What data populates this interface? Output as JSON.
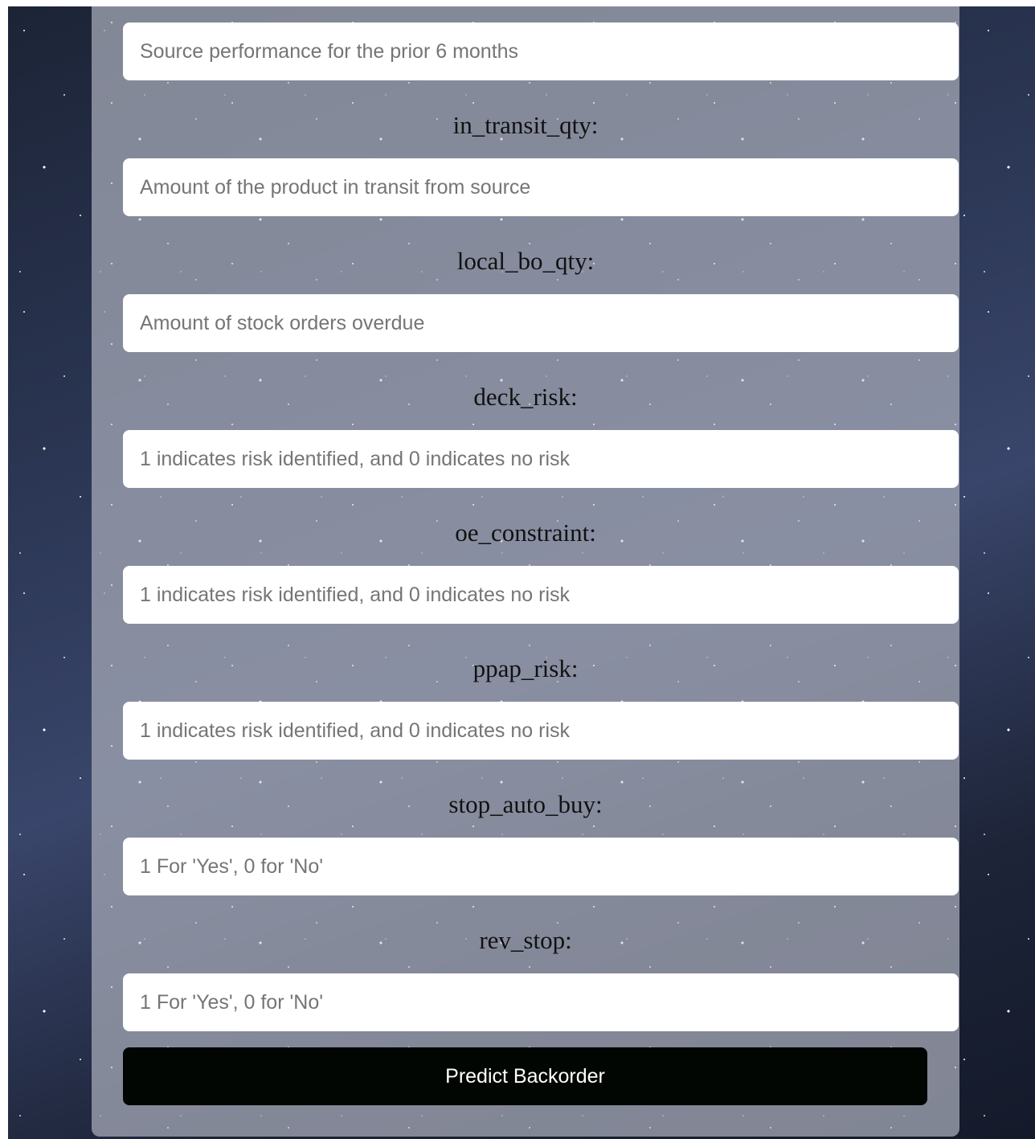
{
  "form": {
    "fields": [
      {
        "label": "",
        "placeholder": "Source performance for the prior 6 months"
      },
      {
        "label": "in_transit_qty:",
        "placeholder": "Amount of the product in transit from source"
      },
      {
        "label": "local_bo_qty:",
        "placeholder": "Amount of stock orders overdue"
      },
      {
        "label": "deck_risk:",
        "placeholder": "1 indicates risk identified, and 0 indicates no risk"
      },
      {
        "label": "oe_constraint:",
        "placeholder": "1 indicates risk identified, and 0 indicates no risk"
      },
      {
        "label": "ppap_risk:",
        "placeholder": "1 indicates risk identified, and 0 indicates no risk"
      },
      {
        "label": "stop_auto_buy:",
        "placeholder": "1 For 'Yes', 0 for 'No'"
      },
      {
        "label": "rev_stop:",
        "placeholder": "1 For 'Yes', 0 for 'No'"
      }
    ],
    "submit_label": "Predict Backorder"
  }
}
